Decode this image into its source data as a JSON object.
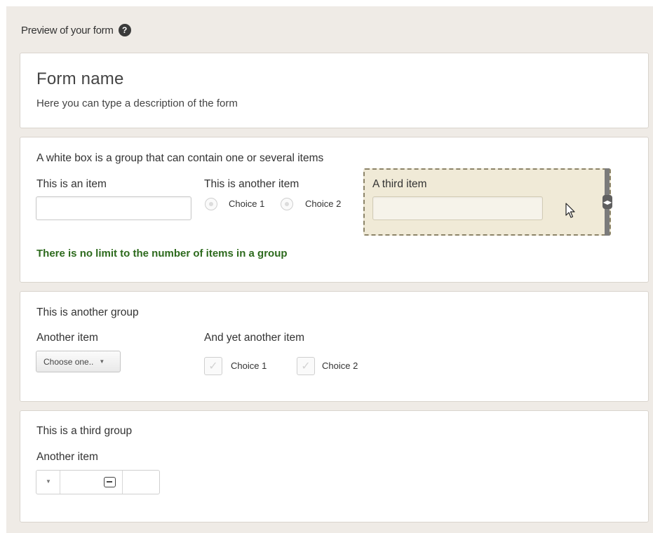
{
  "header": {
    "title": "Preview of your form",
    "help_icon": "question-circle-icon"
  },
  "form": {
    "name": "Form name",
    "description": "Here you can type a description of the form"
  },
  "group1": {
    "title": "A white box is a group that can contain one or several items",
    "item1_label": "This is an item",
    "item2_label": "This is another item",
    "item2_choices": [
      "Choice 1",
      "Choice 2"
    ],
    "item3_label": "A third item",
    "note": "There is no limit to the number of items in a group"
  },
  "group2": {
    "title": "This is another group",
    "item1_label": "Another item",
    "select_value": "Choose one..",
    "item2_label": "And yet another item",
    "item2_choices": [
      "Choice 1",
      "Choice 2"
    ]
  },
  "group3": {
    "title": "This is a third group",
    "item1_label": "Another item"
  },
  "colors": {
    "background": "#efebe6",
    "selected_item": "#f0ead7",
    "note_green": "#2d6a1d"
  }
}
